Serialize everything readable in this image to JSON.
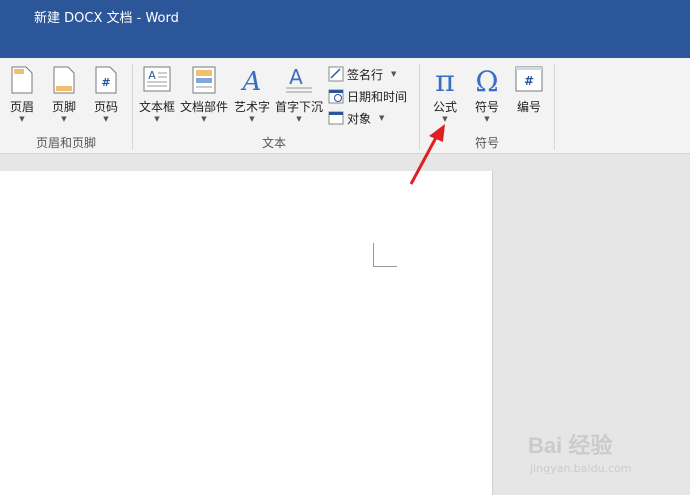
{
  "window": {
    "title": "新建 DOCX 文档 - Word"
  },
  "ribbon": {
    "groups": {
      "header_footer": {
        "label": "页眉和页脚",
        "header": "页眉",
        "footer": "页脚",
        "page_number": "页码"
      },
      "text": {
        "label": "文本",
        "text_box": "文本框",
        "quick_parts": "文档部件",
        "wordart": "艺术字",
        "drop_cap": "首字下沉",
        "signature_line": "签名行",
        "date_time": "日期和时间",
        "object": "对象"
      },
      "symbols": {
        "label": "符号",
        "equation": "公式",
        "symbol": "符号",
        "numbering": "编号"
      }
    },
    "dropdown_glyph": "▼"
  },
  "watermark": {
    "brand": "Bai 经验",
    "url": "jingyan.baidu.com"
  },
  "colors": {
    "titlebar": "#2b579a",
    "ribbon": "#f3f3f3",
    "accent": "#2b579a",
    "arrow": "#e02020"
  }
}
